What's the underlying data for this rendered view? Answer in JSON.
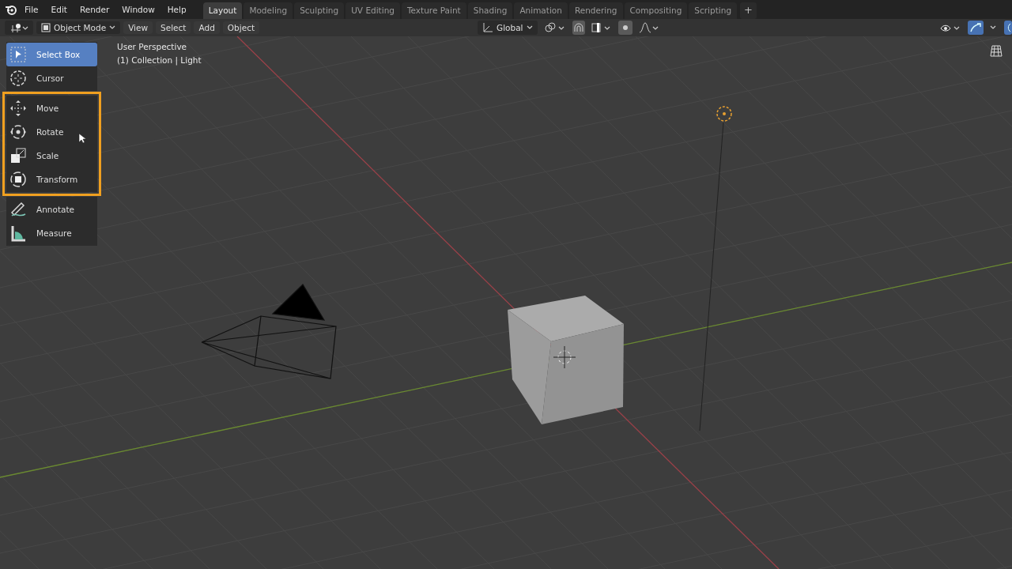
{
  "topbar": {
    "menus": [
      "File",
      "Edit",
      "Render",
      "Window",
      "Help"
    ],
    "workspaces": [
      {
        "label": "Layout",
        "selected": true
      },
      {
        "label": "Modeling",
        "selected": false
      },
      {
        "label": "Sculpting",
        "selected": false
      },
      {
        "label": "UV Editing",
        "selected": false
      },
      {
        "label": "Texture Paint",
        "selected": false
      },
      {
        "label": "Shading",
        "selected": false
      },
      {
        "label": "Animation",
        "selected": false
      },
      {
        "label": "Rendering",
        "selected": false
      },
      {
        "label": "Compositing",
        "selected": false
      },
      {
        "label": "Scripting",
        "selected": false
      }
    ],
    "add_tab": "+"
  },
  "header": {
    "mode": "Object Mode",
    "menus": [
      "View",
      "Select",
      "Add",
      "Object"
    ],
    "orientation": "Global",
    "snap_on": true,
    "proportional_on": true,
    "gizmo_on": true
  },
  "overlay": {
    "view_name": "User Perspective",
    "collection": "(1) Collection | Light"
  },
  "toolbar": [
    {
      "highlighted": false,
      "tools": [
        {
          "label": "Select Box",
          "kind": "select",
          "selected": true
        },
        {
          "label": "Cursor",
          "kind": "cursor",
          "selected": false
        }
      ]
    },
    {
      "highlighted": true,
      "tools": [
        {
          "label": "Move",
          "kind": "move",
          "selected": false
        },
        {
          "label": "Rotate",
          "kind": "rotate",
          "selected": false
        },
        {
          "label": "Scale",
          "kind": "scale",
          "selected": false
        },
        {
          "label": "Transform",
          "kind": "transform",
          "selected": false
        }
      ]
    },
    {
      "highlighted": false,
      "tools": [
        {
          "label": "Annotate",
          "kind": "annotate",
          "selected": false
        },
        {
          "label": "Measure",
          "kind": "measure",
          "selected": false
        }
      ]
    }
  ]
}
